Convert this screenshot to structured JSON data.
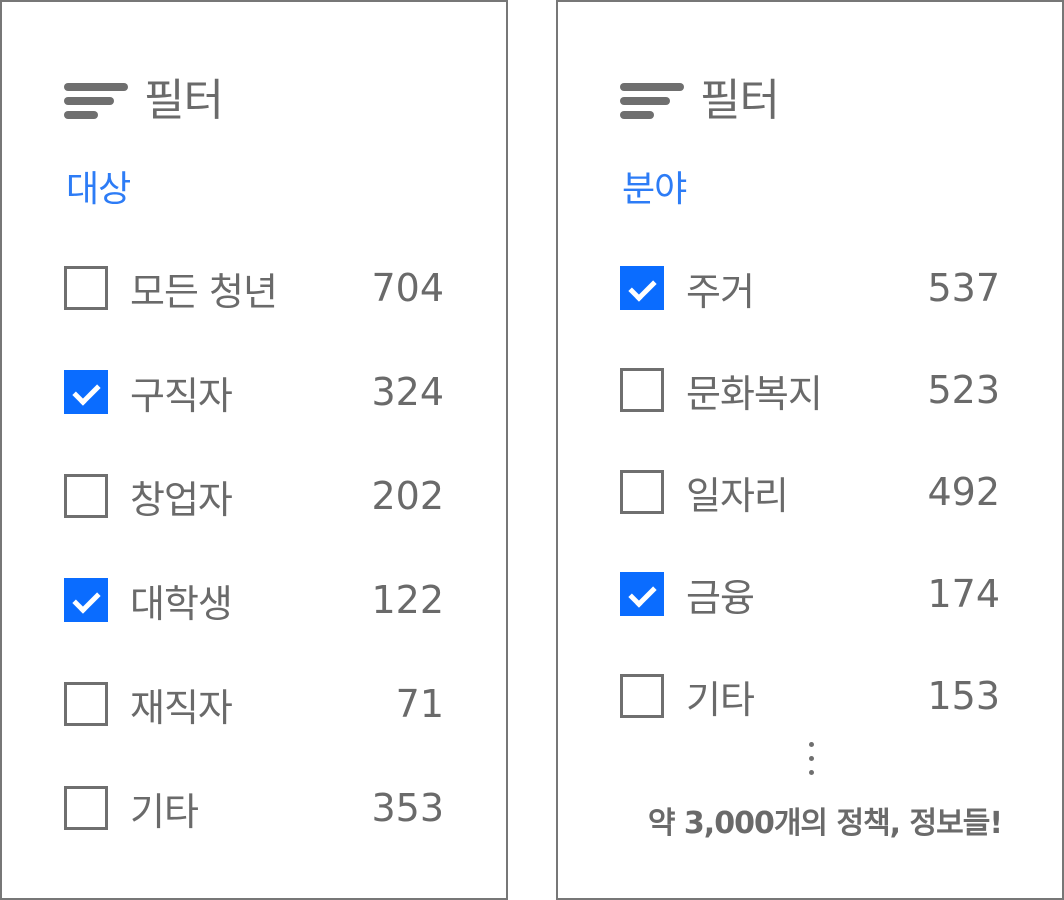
{
  "left_panel": {
    "title": "필터",
    "section": "대상",
    "items": [
      {
        "label": "모든 청년",
        "count": "704",
        "checked": false
      },
      {
        "label": "구직자",
        "count": "324",
        "checked": true
      },
      {
        "label": "창업자",
        "count": "202",
        "checked": false
      },
      {
        "label": "대학생",
        "count": "122",
        "checked": true
      },
      {
        "label": "재직자",
        "count": "71",
        "checked": false
      },
      {
        "label": "기타",
        "count": "353",
        "checked": false
      }
    ]
  },
  "right_panel": {
    "title": "필터",
    "section": "분야",
    "items": [
      {
        "label": "주거",
        "count": "537",
        "checked": true
      },
      {
        "label": "문화복지",
        "count": "523",
        "checked": false
      },
      {
        "label": "일자리",
        "count": "492",
        "checked": false
      },
      {
        "label": "금융",
        "count": "174",
        "checked": true
      },
      {
        "label": "기타",
        "count": "153",
        "checked": false
      }
    ],
    "note": "약 3,000개의 정책, 정보들!"
  },
  "colors": {
    "accent": "#0a6cff",
    "section_label": "#2d7cf6",
    "text": "#6a6a6a",
    "border": "#777777"
  },
  "icons": {
    "header": "filter-icon",
    "checked": "checkmark-icon",
    "more": "vertical-ellipsis-icon"
  }
}
